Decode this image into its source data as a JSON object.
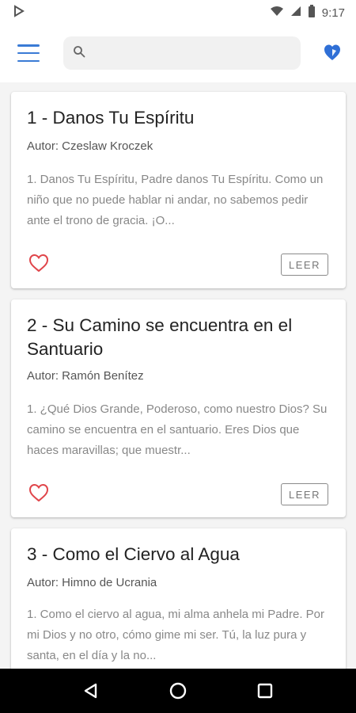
{
  "status_bar": {
    "time": "9:17"
  },
  "toolbar": {
    "search_placeholder": "",
    "icons": [
      "menu-icon",
      "search-icon",
      "heart-shield-icon"
    ],
    "accent_color": "#3a7bd5"
  },
  "songs": [
    {
      "title": "1 - Danos Tu Espíritu",
      "author": "Autor: Czeslaw Kroczek",
      "excerpt": "1. Danos Tu Espíritu, Padre danos Tu Espíritu. Como un niño que no puede hablar ni andar, no sabemos pedir ante el trono de gracia. ¡O...",
      "action": "LEER"
    },
    {
      "title": "2 - Su Camino se encuentra en el Santuario",
      "author": "Autor: Ramón Benítez",
      "excerpt": "1. ¿Qué Dios Grande, Poderoso, como nuestro Dios? Su camino se encuentra en el santuario. Eres Dios que haces maravillas; que muestr...",
      "action": "LEER"
    },
    {
      "title": "3 - Como el Ciervo al Agua",
      "author": "Autor: Himno de Ucrania",
      "excerpt": "1. Como el ciervo al agua, mi alma anhela mi Padre. Por mi Dios y no otro, cómo gime mi ser. Tú, la luz pura y santa, en el día y la no..."
    }
  ],
  "colors": {
    "heart": "#e0454a",
    "nav_bar": "#000000"
  }
}
